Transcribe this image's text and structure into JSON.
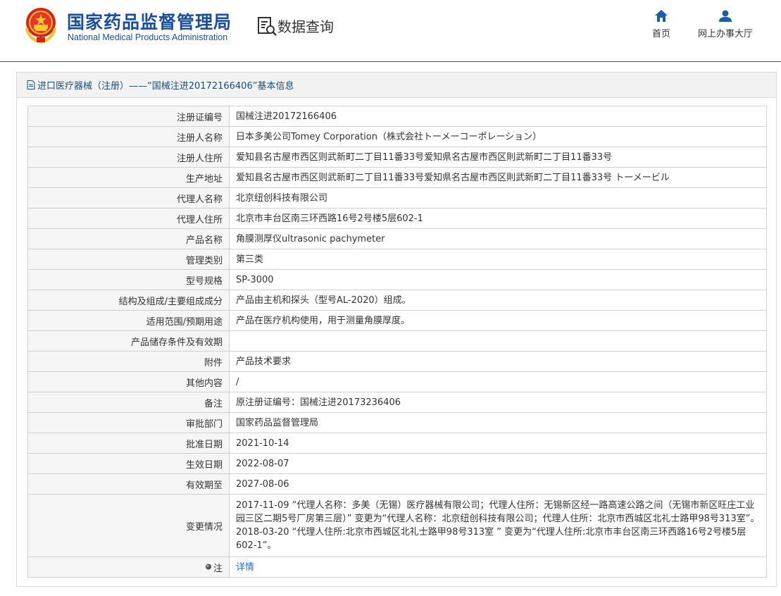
{
  "header": {
    "logo_cn": "国家药品监督管理局",
    "logo_en": "National Medical Products Administration",
    "section_title": "数据查询",
    "nav": [
      {
        "label": "首页",
        "icon": "home-icon"
      },
      {
        "label": "网上办事大厅",
        "icon": "user-icon"
      }
    ]
  },
  "panel": {
    "title": "进口医疗器械（注册）——“国械注进20172166406”基本信息"
  },
  "rows": [
    {
      "key": "注册证编号",
      "value": "国械注进20172166406"
    },
    {
      "key": "注册人名称",
      "value": "日本多美公司Tomey Corporation（株式会社トーメーコーポレーション）"
    },
    {
      "key": "注册人住所",
      "value": "爱知县名古屋市西区则武新町二丁目11番33号爱知県名古屋市西区則武新町二丁目11番33号"
    },
    {
      "key": "生产地址",
      "value": "爱知县名古屋市西区则武新町二丁目11番33号爱知県名古屋市西区則武新町二丁目11番33号 トーメービル"
    },
    {
      "key": "代理人名称",
      "value": "北京纽创科技有限公司"
    },
    {
      "key": "代理人住所",
      "value": "北京市丰台区南三环西路16号2号楼5层602-1"
    },
    {
      "key": "产品名称",
      "value": "角膜测厚仪ultrasonic pachymeter"
    },
    {
      "key": "管理类别",
      "value": "第三类"
    },
    {
      "key": "型号规格",
      "value": "SP-3000"
    },
    {
      "key": "结构及组成/主要组成成分",
      "value": "产品由主机和探头（型号AL-2020）组成。"
    },
    {
      "key": "适用范围/预期用途",
      "value": "产品在医疗机构使用，用于测量角膜厚度。"
    },
    {
      "key": "产品储存条件及有效期",
      "value": ""
    },
    {
      "key": "附件",
      "value": "产品技术要求"
    },
    {
      "key": "其他内容",
      "value": "/"
    },
    {
      "key": "备注",
      "value": "原注册证编号：国械注进20173236406"
    },
    {
      "key": "审批部门",
      "value": "国家药品监督管理局"
    },
    {
      "key": "批准日期",
      "value": "2021-10-14"
    },
    {
      "key": "生效日期",
      "value": "2022-08-07"
    },
    {
      "key": "有效期至",
      "value": "2027-08-06"
    }
  ],
  "change": {
    "key": "变更情况",
    "value": "2017-11-09 “代理人名称：多美（无锡）医疗器械有限公司；代理人住所：无锡新区经一路高速公路之间（无锡市新区旺庄工业园三区二期5号厂房第三层）” 变更为“代理人名称：北京纽创科技有限公司；代理人住所：北京市西城区北礼士路甲98号313室”。 2018-03-20 “代理人住所:北京市西城区北礼士路甲98号313室 ” 变更为“代理人住所:北京市丰台区南三环西路16号2号楼5层602-1”。"
  },
  "note": {
    "key": "注",
    "link": "详情"
  },
  "colors": {
    "brand_blue": "#1a4e9c",
    "link_blue": "#1a6fc8",
    "header_line": "#1a5ea8"
  }
}
